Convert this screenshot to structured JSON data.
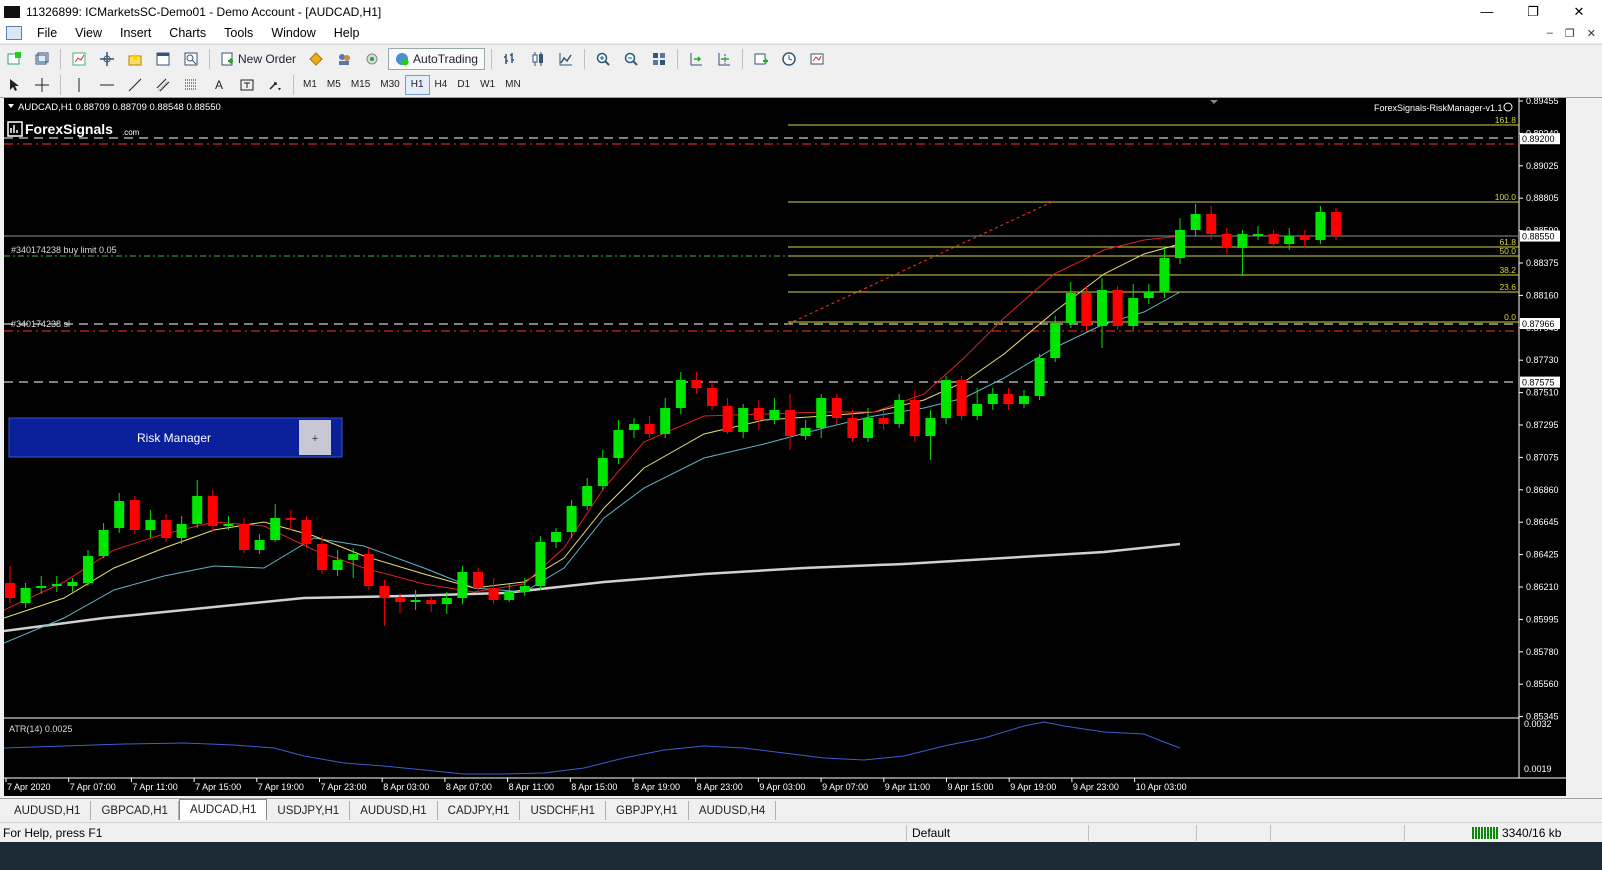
{
  "window": {
    "title": "11326899: ICMarketsSC-Demo01 - Demo Account - [AUDCAD,H1]",
    "minimize_glyph": "—",
    "restore_glyph": "❐",
    "close_glyph": "✕"
  },
  "menu": {
    "items": [
      "File",
      "View",
      "Insert",
      "Charts",
      "Tools",
      "Window",
      "Help"
    ],
    "mdi_minimize": "–",
    "mdi_restore": "❐",
    "mdi_close": "✕"
  },
  "toolbar": {
    "new_order_label": "New Order",
    "autotrading_label": "AutoTrading",
    "timeframes": [
      "M1",
      "M5",
      "M15",
      "M30",
      "H1",
      "H4",
      "D1",
      "W1",
      "MN"
    ],
    "active_timeframe": "H1",
    "line_studies": {
      "text_tool": "A"
    }
  },
  "chart": {
    "symbol_header": "AUDCAD,H1  0.88709 0.88709 0.88548 0.88550",
    "logo_text": "ForexSignals",
    "logo_suffix": ".com",
    "indicator_label": "ForexSignals-RiskManager-v1.1",
    "order_buy_limit_label": "#340174238 buy limit 0.05",
    "order_sl_label": "#340174238 sl",
    "risk_manager_button": "Risk Manager",
    "risk_manager_plus": "+",
    "atr_label": "ATR(14) 0.0025",
    "price_axis": [
      "0.89455",
      "0.89240",
      "0.89025",
      "0.88805",
      "0.88590",
      "0.88375",
      "0.88160",
      "0.87945",
      "0.87730",
      "0.87510",
      "0.87295",
      "0.87075",
      "0.86860",
      "0.86645",
      "0.86425",
      "0.86210",
      "0.85995",
      "0.85780",
      "0.85560",
      "0.85345"
    ],
    "price_boxes": {
      "tp": "0.89200",
      "current": "0.88550",
      "sl": "0.87966",
      "entry_line": "0.87575"
    },
    "fib_levels": [
      {
        "label": "161.8"
      },
      {
        "label": "100.0"
      },
      {
        "label": "61.8"
      },
      {
        "label": "50.0"
      },
      {
        "label": "38.2"
      },
      {
        "label": "23.6"
      },
      {
        "label": "0.0"
      }
    ],
    "atr_axis": [
      "0.0032",
      "0.0019"
    ],
    "time_axis": [
      "7 Apr 2020",
      "7 Apr 07:00",
      "7 Apr 11:00",
      "7 Apr 15:00",
      "7 Apr 19:00",
      "7 Apr 23:00",
      "8 Apr 03:00",
      "8 Apr 07:00",
      "8 Apr 11:00",
      "8 Apr 15:00",
      "8 Apr 19:00",
      "8 Apr 23:00",
      "9 Apr 03:00",
      "9 Apr 07:00",
      "9 Apr 11:00",
      "9 Apr 15:00",
      "9 Apr 19:00",
      "9 Apr 23:00",
      "10 Apr 03:00"
    ],
    "colors": {
      "background": "#000000",
      "bull": "#00e600",
      "bear": "#ff0000",
      "ma_fast": "#e02020",
      "ma_mid": "#e8e070",
      "ma_slow": "#5fb6c8",
      "ma_long": "#d0d0d0",
      "fib": "#d6d640",
      "atr": "#3a5fd0"
    }
  },
  "tabs": [
    "AUDUSD,H1",
    "GBPCAD,H1",
    "AUDCAD,H1",
    "USDJPY,H1",
    "AUDUSD,H1",
    "CADJPY,H1",
    "USDCHF,H1",
    "GBPJPY,H1",
    "AUDUSD,H4"
  ],
  "active_tab": "AUDCAD,H1",
  "status": {
    "help": "For Help, press F1",
    "profile": "Default",
    "traffic": "3340/16 kb"
  }
}
